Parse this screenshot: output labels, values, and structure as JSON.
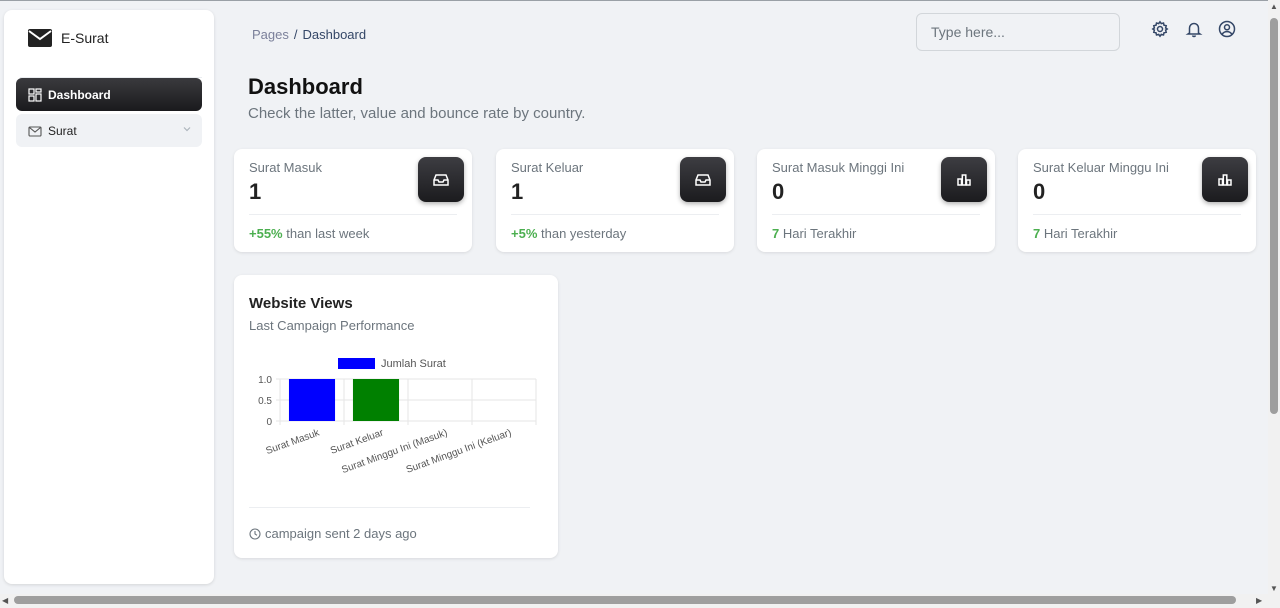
{
  "brand": {
    "name": "E-Surat"
  },
  "sidebar": {
    "items": [
      {
        "label": "Dashboard",
        "icon": "dashboard-icon",
        "active": true
      },
      {
        "label": "Surat",
        "icon": "mail-icon",
        "active": false
      }
    ]
  },
  "breadcrumb": {
    "root": "Pages",
    "separator": "/",
    "current": "Dashboard"
  },
  "search": {
    "placeholder": "Type here..."
  },
  "header_icons": [
    "settings-icon",
    "bell-icon",
    "user-circle-icon"
  ],
  "page": {
    "title": "Dashboard",
    "subtitle": "Check the latter, value and bounce rate by country."
  },
  "cards": [
    {
      "label": "Surat Masuk",
      "value": "1",
      "highlight": "+55%",
      "note": " than last week",
      "icon": "inbox-icon"
    },
    {
      "label": "Surat Keluar",
      "value": "1",
      "highlight": "+5%",
      "note": " than yesterday",
      "icon": "inbox-icon"
    },
    {
      "label": "Surat Masuk Minggi Ini",
      "value": "0",
      "highlight": "7",
      "note": " Hari Terakhir",
      "icon": "bar-chart-icon"
    },
    {
      "label": "Surat Keluar Minggu Ini",
      "value": "0",
      "highlight": "7",
      "note": " Hari Terakhir",
      "icon": "bar-chart-icon"
    }
  ],
  "views_card": {
    "title": "Website Views",
    "subtitle": "Last Campaign Performance",
    "footer": "campaign sent 2 days ago"
  },
  "colors": {
    "positive": "#4caf50",
    "bar_masuk": "#0000ff",
    "bar_keluar": "#008000"
  },
  "chart_data": {
    "type": "bar",
    "categories": [
      "Surat Masuk",
      "Surat Keluar",
      "Surat Minggu Ini (Masuk)",
      "Surat Minggu Ini (Keluar)"
    ],
    "series": [
      {
        "name": "Jumlah Surat",
        "values": [
          1,
          1,
          0,
          0
        ]
      }
    ],
    "bar_colors": [
      "#0000ff",
      "#008000",
      "#0000ff",
      "#008000"
    ],
    "y_ticks": [
      "0",
      "0.5",
      "1.0"
    ],
    "ylim": [
      0,
      1
    ],
    "grid": true,
    "legend": "top"
  }
}
